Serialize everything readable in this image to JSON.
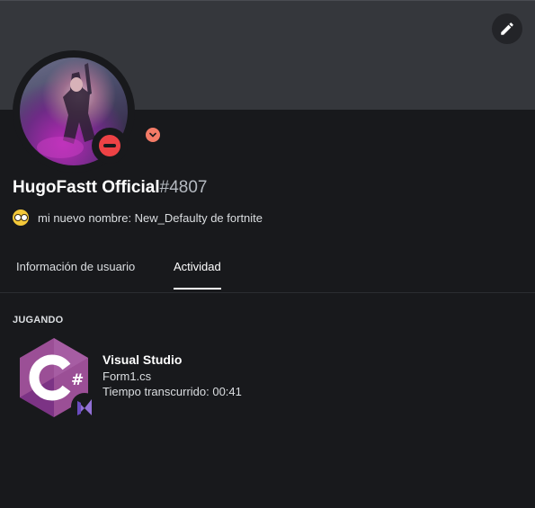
{
  "profile": {
    "name": "HugoFastt Official",
    "discriminator": "#4807",
    "status": "do-not-disturb",
    "custom_status": "mi nuevo nombre: New_Defaulty de fortnite",
    "custom_status_emoji": "pleading-face-emoji"
  },
  "header": {
    "edit_icon": "pencil-icon"
  },
  "tabs": [
    {
      "label": "Información de usuario",
      "active": false
    },
    {
      "label": "Actividad",
      "active": true
    }
  ],
  "activity": {
    "section_label": "JUGANDO",
    "game": {
      "name": "Visual Studio",
      "detail": "Form1.cs",
      "elapsed": "Tiempo transcurrido: 00:41",
      "icon": "csharp-icon",
      "small_icon": "visual-studio-icon"
    }
  },
  "colors": {
    "background": "#18191c",
    "banner": "#35373c",
    "dnd": "#ed4245",
    "nitro": "#f47b67",
    "csharp_purple": "#9b4f96"
  }
}
